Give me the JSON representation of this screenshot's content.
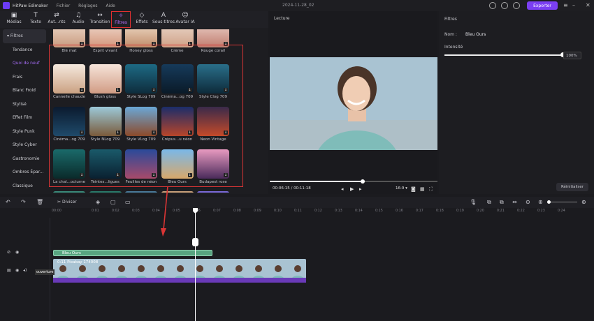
{
  "app": {
    "name": "HitPaw Edimakor",
    "project": "2024-11-28_02",
    "menu": [
      "Fichier",
      "Réglages",
      "Aide"
    ],
    "export_label": "Exporter"
  },
  "toolbar": {
    "items": [
      {
        "label": "Médias",
        "icon": "media-icon"
      },
      {
        "label": "Texte",
        "icon": "text-icon"
      },
      {
        "label": "Aut...nts",
        "icon": "auto-subtitles-icon"
      },
      {
        "label": "Audio",
        "icon": "audio-icon"
      },
      {
        "label": "Transition",
        "icon": "transition-icon"
      },
      {
        "label": "Filtres",
        "icon": "filters-icon",
        "active": true
      },
      {
        "label": "Effets",
        "icon": "effects-icon"
      },
      {
        "label": "Sous-titres",
        "icon": "subtitles-icon"
      },
      {
        "label": "Avatar IA",
        "icon": "avatar-icon"
      }
    ]
  },
  "categories": [
    "Filtres",
    "Tendance",
    "Quoi de neuf",
    "Frais",
    "Blanc Froid",
    "Stylisé",
    "Effet Film",
    "Style Punk",
    "Style Cyber",
    "Gastronomie",
    "Ombres Épar...",
    "Classique"
  ],
  "selected_category": "Quoi de neuf",
  "filters": [
    [
      "Blé mat",
      "Esprit vivant",
      "Honey gloss",
      "Crème",
      "Rouge corail"
    ],
    [
      "Cannelle chaude",
      "Blush gloss",
      "Style SLog 709",
      "Cinéma...og 709",
      "Style Clog 709"
    ],
    [
      "Cinéma...og 709",
      "Style NLog 709",
      "Style VLog 709",
      "Crépus...u néon",
      "Neon Vintage"
    ],
    [
      "La chal...octurne",
      "Teintes...ligues",
      "Feuilles de néon",
      "Bleu Ours",
      "Budapest rose"
    ]
  ],
  "preview": {
    "header": "Lecture",
    "time_current": "00:06:15",
    "time_total": "00:11:18",
    "ratio": "16:9",
    "progress": 0.55
  },
  "filter_panel": {
    "header": "Filtres",
    "name_label": "Nom :",
    "name_value": "Bleu Ours",
    "intensity_label": "Intensité",
    "intensity_value": "100%",
    "intensity": 1.0,
    "reset_label": "Réinitialiser"
  },
  "timeline": {
    "split_label": "Diviser",
    "ticks": [
      "00:00",
      "0:01",
      "0:02",
      "0:03",
      "0:04",
      "0:05",
      "0:06",
      "0:07",
      "0:08",
      "0:09",
      "0:10",
      "0:11",
      "0:12",
      "0:13",
      "0:14",
      "0:15",
      "0:16",
      "0:17",
      "0:18",
      "0:19",
      "0:20",
      "0:21",
      "0:22",
      "0:23",
      "0:24"
    ],
    "filter_clip": "Bleu Ours",
    "video_clip": "0:11  Pixabay 174008",
    "cover_label": "ouverture"
  }
}
